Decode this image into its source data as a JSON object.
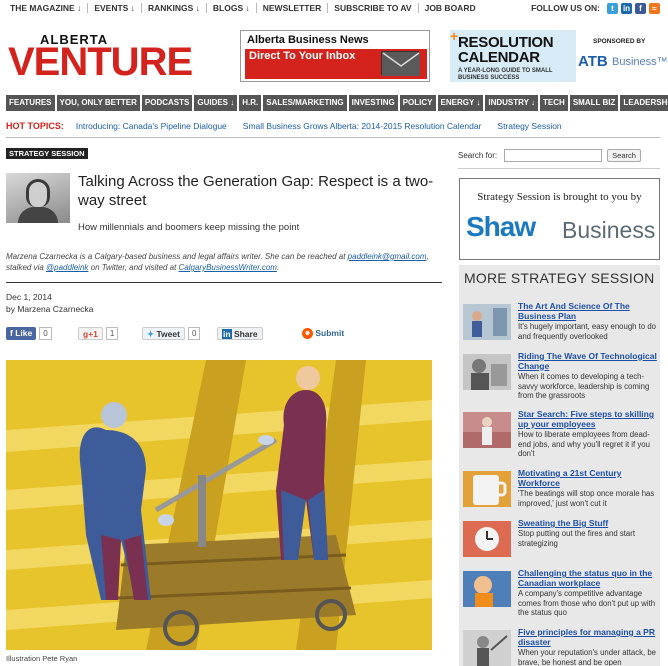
{
  "topnav": {
    "items": [
      "THE MAGAZINE ↓",
      "EVENTS ↓",
      "RANKINGS ↓",
      "BLOGS ↓",
      "NEWSLETTER",
      "SUBSCRIBE TO AV",
      "JOB BOARD"
    ],
    "follow_label": "FOLLOW US ON:",
    "social": [
      {
        "icon": "twitter-icon",
        "glyph": "t",
        "color": "#3a9fd8"
      },
      {
        "icon": "linkedin-icon",
        "glyph": "in",
        "color": "#1c6aa8"
      },
      {
        "icon": "facebook-icon",
        "glyph": "f",
        "color": "#3b5998"
      },
      {
        "icon": "rss-icon",
        "glyph": "≈",
        "color": "#f0761c"
      }
    ]
  },
  "header": {
    "logo_top": "ALBERTA",
    "logo_main": "VENTURE",
    "ad1_title": "Alberta Business News",
    "ad1_cta": "Direct To Your Inbox",
    "ad2_plus": "+",
    "ad2_title": "RESOLUTION CALENDAR",
    "ad2_sub": "A YEAR-LONG GUIDE TO SMALL BUSINESS SUCCESS",
    "sponsor_label": "SPONSORED BY",
    "sponsor_name": "ATB",
    "sponsor_suffix": "Business™"
  },
  "mainnav": [
    "FEATURES",
    "YOU, ONLY BETTER",
    "PODCASTS",
    "GUIDES ↓",
    "H.R.",
    "SALES/MARKETING",
    "INVESTING",
    "POLICY",
    "ENERGY ↓",
    "INDUSTRY ↓",
    "TECH",
    "SMALL BIZ",
    "LEADERSHIP"
  ],
  "hot_topics": {
    "label": "HOT TOPICS:",
    "items": [
      "Introducing: Canada's Pipeline Dialogue",
      "Small Business Grows Alberta: 2014-2015 Resolution Calendar",
      "Strategy Session"
    ]
  },
  "article": {
    "category": "STRATEGY SESSION",
    "title": "Talking Across the Generation Gap: Respect is a two-way street",
    "subtitle": "How millennials and boomers keep missing the point",
    "bio_1": "Marzena Czarnecka is a Calgary-based business and legal affairs writer. She can be reached at ",
    "bio_email": "paddleink@gmail.com",
    "bio_2": ", stalked via ",
    "bio_handle": "@paddleink",
    "bio_3": " on Twitter, and visited at ",
    "bio_site": "CalgaryBusinessWriter.com",
    "bio_4": ".",
    "date": "Dec 1, 2014",
    "byline": "by Marzena Czarnecka",
    "caption": "Illustration Pete Ryan"
  },
  "share": {
    "like_label": "Like",
    "like_count": "0",
    "gplus_label": "+1",
    "gplus_count": "1",
    "tweet_label": "Tweet",
    "tweet_count": "0",
    "linkedin_label": "Share",
    "submit_label": "Submit"
  },
  "sidebar": {
    "search_label": "Search for:",
    "search_value": "",
    "search_button": "Search",
    "ad_text": "Strategy Session is brought to you by",
    "ad_brand": "Shaw",
    "ad_brand_suffix": "Business",
    "more_heading": "MORE STRATEGY SESSION",
    "items": [
      {
        "title": "The Art And Science Of The Business Plan",
        "text": "It's hugely important, easy enough to do and frequently overlooked"
      },
      {
        "title": "Riding The Wave Of Technological Change",
        "text": "When it comes to developing a tech-savvy workforce, leadership is coming from the grassroots"
      },
      {
        "title": "Star Search: Five steps to skilling up your employees",
        "text": "How to liberate employees from dead-end jobs, and why you'll regret it if you don't"
      },
      {
        "title": "Motivating a 21st Century Workforce",
        "text": "'The beatings will stop once morale has improved,' just won't cut it"
      },
      {
        "title": "Sweating the Big Stuff",
        "text": "Stop putting out the fires and start strategizing"
      },
      {
        "title": "Challenging the status quo in the Canadian workplace",
        "text": "A company's competitive advantage comes from those who don't put up with the status quo"
      },
      {
        "title": "Five principles for managing a PR disaster",
        "text": "When your reputation's under attack, be brave, be honest and be open"
      }
    ]
  }
}
